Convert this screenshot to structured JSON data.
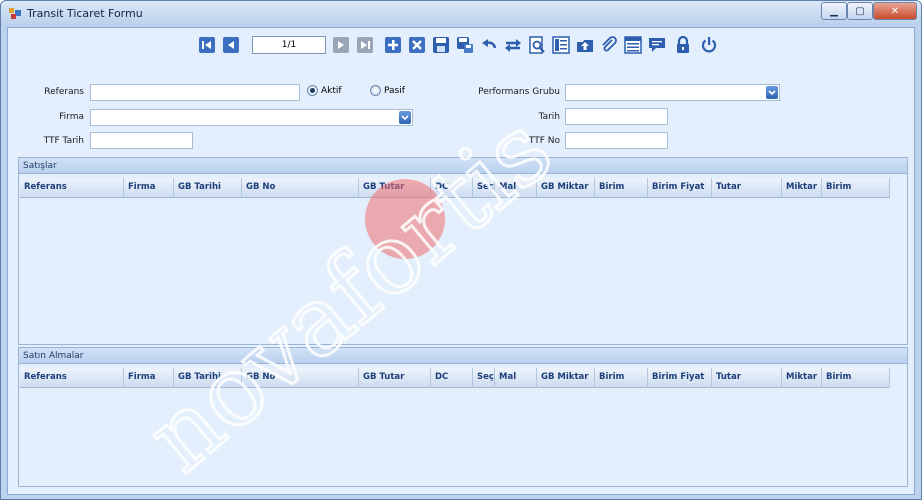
{
  "window": {
    "title": "Transit Ticaret Formu"
  },
  "toolbar": {
    "pager_value": "1/1",
    "icons": [
      "first-icon",
      "prev-icon",
      "next-icon",
      "last-icon",
      "add-icon",
      "delete-icon",
      "save-icon",
      "save-as-icon",
      "undo-icon",
      "refresh-icon",
      "preview-icon",
      "list-icon",
      "upload-folder-icon",
      "attach-icon",
      "table-icon",
      "comment-icon",
      "lock-icon",
      "power-icon"
    ]
  },
  "form": {
    "referans_label": "Referans",
    "aktif_label": "Aktif",
    "pasif_label": "Pasif",
    "firma_label": "Firma",
    "ttf_tarih_label": "TTF Tarih",
    "performans_label": "Performans Grubu",
    "tarih_label": "Tarih",
    "ttf_no_label": "TTF No"
  },
  "satislar": {
    "title": "Satışlar",
    "columns": [
      "Referans",
      "Firma",
      "GB Tarihi",
      "GB No",
      "GB Tutar",
      "DC",
      "Seç",
      "Mal",
      "GB Miktar",
      "Birim",
      "Birim Fiyat",
      "Tutar",
      "Miktar",
      "Birim"
    ]
  },
  "satin_almalar": {
    "title": "Satın Almalar",
    "columns": [
      "Referans",
      "Firma",
      "GB Tarihi",
      "GB No",
      "GB Tutar",
      "DC",
      "Seç",
      "Mal",
      "GB Miktar",
      "Birim",
      "Birim Fiyat",
      "Tutar",
      "Miktar",
      "Birim"
    ]
  },
  "watermark": {
    "text": "novafortis"
  },
  "colors": {
    "accent": "#2f63b3",
    "header_text": "#1d3f7a",
    "background": "#e3effc"
  }
}
